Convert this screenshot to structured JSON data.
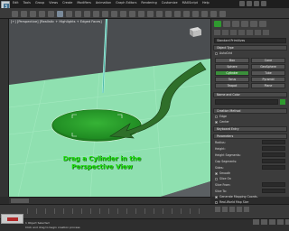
{
  "app": {
    "menu": [
      "Edit",
      "Tools",
      "Group",
      "Views",
      "Create",
      "Modifiers",
      "Animation",
      "Graph Editors",
      "Rendering",
      "Customize",
      "MAXScript",
      "Help"
    ]
  },
  "viewport": {
    "label": "[+] [Perspective] [Realistic + Highlights + Edged Faces]",
    "caption_line1": "Drag a Cylinder in the",
    "caption_line2": "Perspective View"
  },
  "command_panel": {
    "category_dropdown": "Standard Primitives",
    "object_type_header": "Object Type",
    "autogrid_label": "AutoGrid",
    "object_types": [
      "Box",
      "Cone",
      "Sphere",
      "GeoSphere",
      "Cylinder",
      "Tube",
      "Torus",
      "Pyramid",
      "Teapot",
      "Plane"
    ],
    "selected_object_type": "Cylinder",
    "name_color_header": "Name and Color",
    "creation_method_header": "Creation Method",
    "creation_methods": [
      "Edge",
      "Center"
    ],
    "keyboard_entry_header": "Keyboard Entry",
    "parameters_header": "Parameters",
    "params": [
      "Radius:",
      "Height:",
      "Height Segments:",
      "Cap Segments:",
      "Sides:"
    ],
    "smooth_label": "Smooth",
    "slice_on_label": "Slice On",
    "slice_from_label": "Slice From:",
    "slice_to_label": "Slice To:",
    "generate_mapping_label": "Generate Mapping Coords.",
    "real_world_label": "Real-World Map Size"
  },
  "status": {
    "line1": "1 Object Selected",
    "line2": "Click and drag to begin creation process"
  },
  "colors": {
    "viewport_ground": "#8fe0b0",
    "cylinder": "#2fa02f",
    "arrow": "#2f6f2a",
    "caption": "#20e010",
    "selected_tab": "#2f9a2f"
  }
}
